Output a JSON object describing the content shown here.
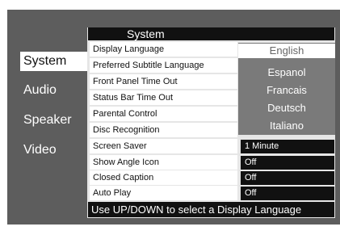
{
  "sidebar": {
    "tabs": [
      {
        "label": "System"
      },
      {
        "label": "Audio"
      },
      {
        "label": "Speaker"
      },
      {
        "label": "Video"
      }
    ]
  },
  "panel": {
    "title": "System",
    "settings": [
      {
        "label": "Display Language"
      },
      {
        "label": "Preferred Subtitle Language"
      },
      {
        "label": "Front Panel Time Out"
      },
      {
        "label": "Status Bar Time Out"
      },
      {
        "label": "Parental Control"
      },
      {
        "label": "Disc Recognition"
      },
      {
        "label": "Screen Saver",
        "value": "1 Minute"
      },
      {
        "label": "Show Angle Icon",
        "value": "Off"
      },
      {
        "label": "Closed Caption",
        "value": "Off"
      },
      {
        "label": "Auto Play",
        "value": "Off"
      }
    ],
    "language_options": [
      "English",
      "Espanol",
      "Francais",
      "Deutsch",
      "Italiano"
    ],
    "selected_language": "English"
  },
  "status": {
    "message": "Use UP/DOWN to select a Display Language"
  }
}
